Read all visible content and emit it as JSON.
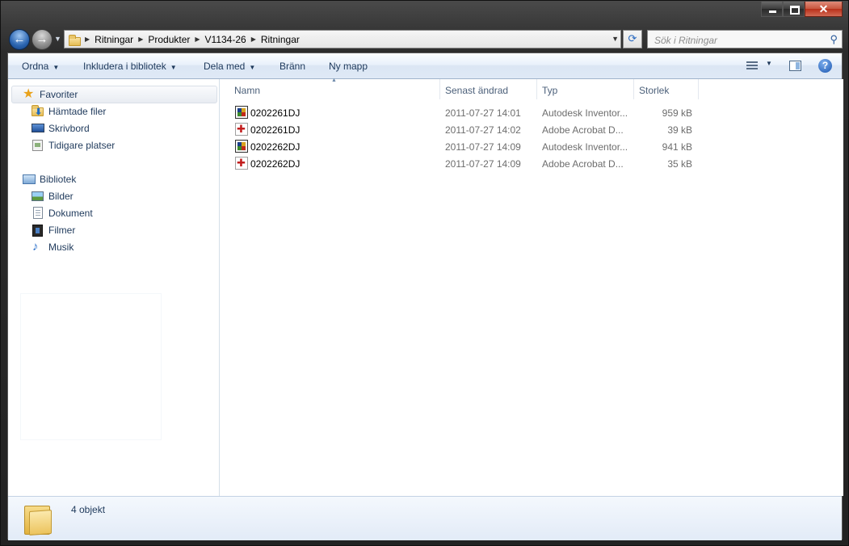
{
  "address": {
    "breadcrumbs": [
      "Ritningar",
      "Produkter",
      "V1134-26",
      "Ritningar"
    ]
  },
  "search": {
    "placeholder": "Sök i Ritningar"
  },
  "toolbar": {
    "organize": "Ordna",
    "include_library": "Inkludera i bibliotek",
    "share": "Dela med",
    "burn": "Bränn",
    "new_folder": "Ny mapp",
    "help": "?"
  },
  "sidebar": {
    "favorites": {
      "label": "Favoriter",
      "items": [
        {
          "label": "Hämtade filer",
          "icon": "downloads-icon"
        },
        {
          "label": "Skrivbord",
          "icon": "desktop-icon"
        },
        {
          "label": "Tidigare platser",
          "icon": "recent-places-icon"
        }
      ]
    },
    "libraries": {
      "label": "Bibliotek",
      "items": [
        {
          "label": "Bilder",
          "icon": "pictures-icon"
        },
        {
          "label": "Dokument",
          "icon": "documents-icon"
        },
        {
          "label": "Filmer",
          "icon": "videos-icon"
        },
        {
          "label": "Musik",
          "icon": "music-icon"
        }
      ]
    }
  },
  "filelist": {
    "columns": [
      "Namn",
      "Senast ändrad",
      "Typ",
      "Storlek"
    ],
    "rows": [
      {
        "name": "0202261DJ",
        "modified": "2011-07-27 14:01",
        "type": "Autodesk Inventor...",
        "size": "959 kB",
        "icon": "inventor-file-icon"
      },
      {
        "name": "0202261DJ",
        "modified": "2011-07-27 14:02",
        "type": "Adobe Acrobat D...",
        "size": "39 kB",
        "icon": "pdf-file-icon"
      },
      {
        "name": "0202262DJ",
        "modified": "2011-07-27 14:09",
        "type": "Autodesk Inventor...",
        "size": "941 kB",
        "icon": "inventor-file-icon"
      },
      {
        "name": "0202262DJ",
        "modified": "2011-07-27 14:09",
        "type": "Adobe Acrobat D...",
        "size": "35 kB",
        "icon": "pdf-file-icon"
      }
    ]
  },
  "details": {
    "count": "4 objekt"
  }
}
